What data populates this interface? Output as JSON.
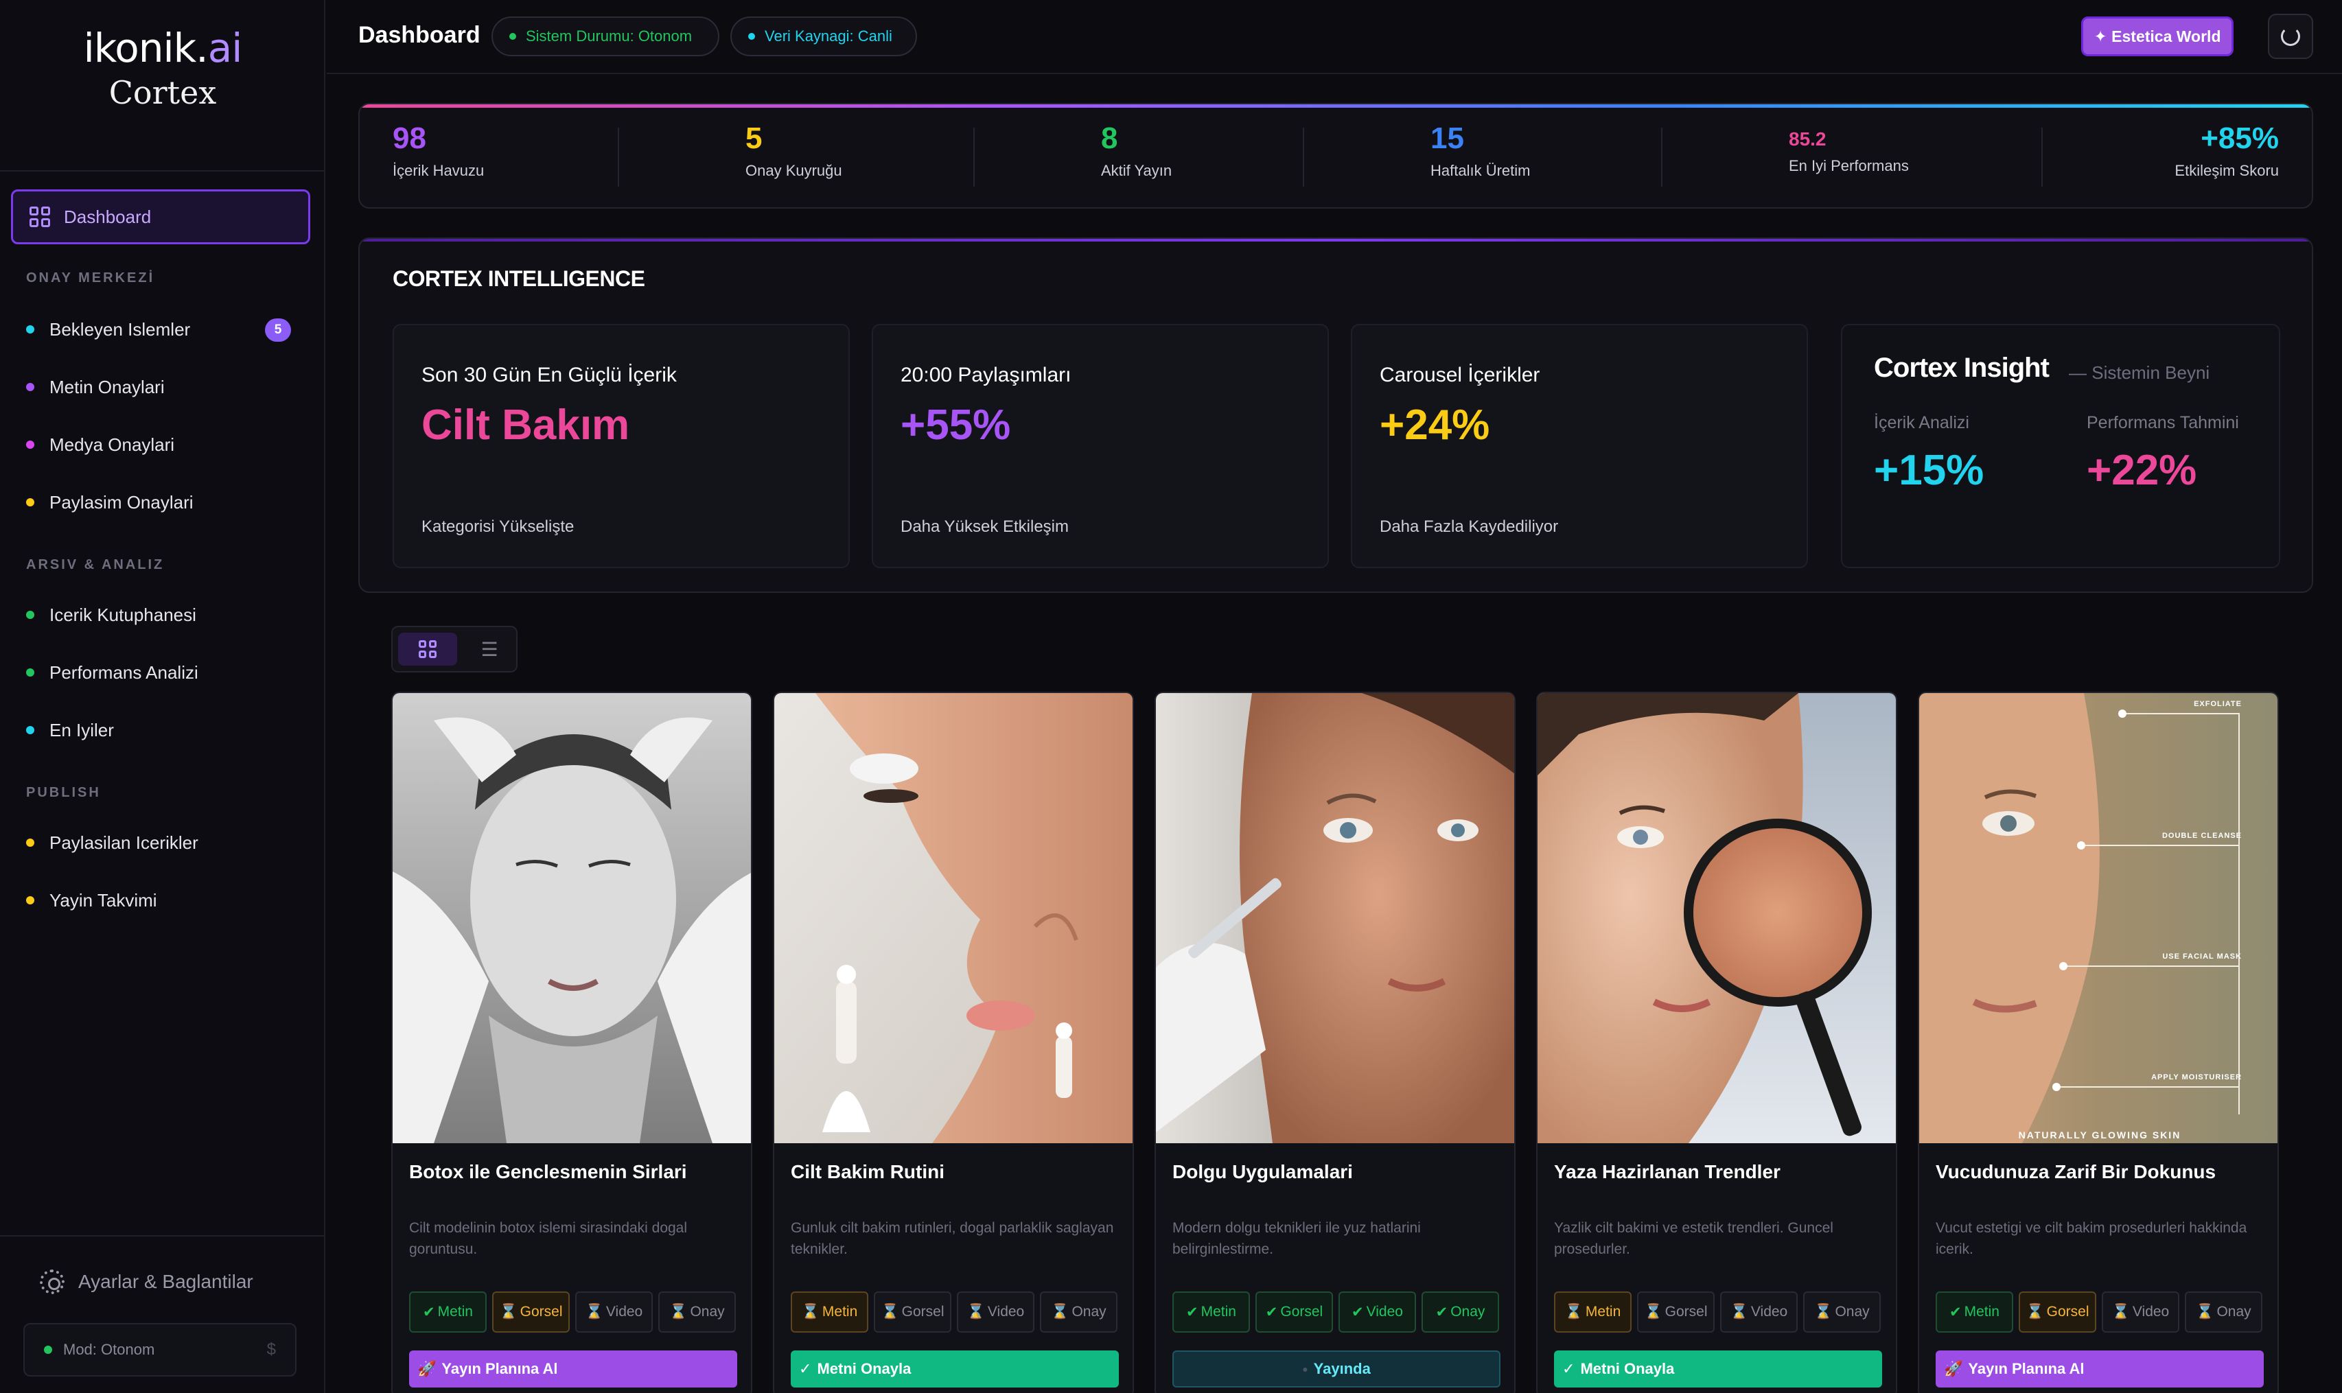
{
  "sidebar": {
    "logo": {
      "main": "ikonik.",
      "ai": "ai",
      "sub": "Cortex"
    },
    "active_item": "Dashboard",
    "sections": [
      {
        "title": "ONAY MERKEZİ",
        "items": [
          {
            "label": "Bekleyen Islemler",
            "color": "#22d3ee",
            "badge": "5"
          },
          {
            "label": "Metin Onaylari",
            "color": "#a855f7"
          },
          {
            "label": "Medya Onaylari",
            "color": "#d946ef"
          },
          {
            "label": "Paylasim Onaylari",
            "color": "#facc15"
          }
        ]
      },
      {
        "title": "ARSIV & ANALIZ",
        "items": [
          {
            "label": "Icerik Kutuphanesi",
            "color": "#22c55e"
          },
          {
            "label": "Performans Analizi",
            "color": "#22c55e"
          },
          {
            "label": "En Iyiler",
            "color": "#22d3ee"
          }
        ]
      },
      {
        "title": "PUBLISH",
        "items": [
          {
            "label": "Paylasilan Icerikler",
            "color": "#facc15"
          },
          {
            "label": "Yayin Takvimi",
            "color": "#facc15"
          }
        ]
      }
    ],
    "settings_label": "Ayarlar & Baglantilar",
    "mode_label": "Mod: Otonom",
    "mode_icon": "$"
  },
  "topbar": {
    "title": "Dashboard",
    "status_pill": "Sistem Durumu: Otonom",
    "source_pill": "Veri Kaynagi: Canli",
    "brand_button": "✦ Estetica World"
  },
  "stats": [
    {
      "value": "98",
      "label": "İçerik Havuzu",
      "color": "#a855f7"
    },
    {
      "value": "5",
      "label": "Onay Kuyruğu",
      "color": "#facc15"
    },
    {
      "value": "8",
      "label": "Aktif Yayın",
      "color": "#22c55e"
    },
    {
      "value": "15",
      "label": "Haftalık Üretim",
      "color": "#3b82f6"
    },
    {
      "value": "85.2",
      "label": "En Iyi Performans",
      "color": "#ec4899"
    },
    {
      "value": "+85%",
      "label": "Etkileşim Skoru",
      "color": "#22d3ee"
    }
  ],
  "intelligence": {
    "title": "CORTEX INTELLIGENCE",
    "cards": [
      {
        "head": "Son 30 Gün En Güçlü İçerik",
        "big": "Cilt Bakım",
        "foot": "Kategorisi Yükselişte",
        "color": "#ec4899"
      },
      {
        "head": "20:00 Paylaşımları",
        "big": "+55%",
        "foot": "Daha Yüksek Etkileşim",
        "color": "#a855f7"
      },
      {
        "head": "Carousel İçerikler",
        "big": "+24%",
        "foot": "Daha Fazla Kaydediliyor",
        "color": "#facc15"
      }
    ],
    "insight": {
      "title": "Cortex Insight",
      "subtitle": "— Sistemin Beyni",
      "left_label": "İçerik Analizi",
      "left_value": "+15%",
      "left_color": "#22d3ee",
      "right_label": "Performans Tahmini",
      "right_value": "+22%",
      "right_color": "#ec4899"
    }
  },
  "view_toggle": {
    "list_icon": "☰"
  },
  "cards": [
    {
      "title": "Botox ile Genclesmenin Sirlari",
      "desc": "Cilt modelinin botox islemi sirasindaki dogal goruntusu.",
      "tags": [
        {
          "label": "Metin",
          "state": "ok",
          "icon": "✔"
        },
        {
          "label": "Gorsel",
          "state": "warn",
          "icon": "⌛"
        },
        {
          "label": "Video",
          "state": "idle",
          "icon": "⌛"
        },
        {
          "label": "Onay",
          "state": "idle",
          "icon": "⌛"
        }
      ],
      "action": {
        "label": "Yayın Planına Al",
        "style": "purple",
        "icon": "🚀"
      }
    },
    {
      "title": "Cilt Bakim Rutini",
      "desc": "Gunluk cilt bakim rutinleri, dogal parlaklik saglayan teknikler.",
      "tags": [
        {
          "label": "Metin",
          "state": "warn",
          "icon": "⌛"
        },
        {
          "label": "Gorsel",
          "state": "idle",
          "icon": "⌛"
        },
        {
          "label": "Video",
          "state": "idle",
          "icon": "⌛"
        },
        {
          "label": "Onay",
          "state": "idle",
          "icon": "⌛"
        }
      ],
      "action": {
        "label": "Metni Onayla",
        "style": "green",
        "icon": "✓"
      }
    },
    {
      "title": "Dolgu Uygulamalari",
      "desc": "Modern dolgu teknikleri ile yuz hatlarini belirginlestirme.",
      "tags": [
        {
          "label": "Metin",
          "state": "ok",
          "icon": "✔"
        },
        {
          "label": "Gorsel",
          "state": "ok",
          "icon": "✔"
        },
        {
          "label": "Video",
          "state": "ok",
          "icon": "✔"
        },
        {
          "label": "Onay",
          "state": "ok",
          "icon": "✔"
        }
      ],
      "action": {
        "label": "Yayında",
        "style": "live",
        "icon": "●"
      }
    },
    {
      "title": "Yaza Hazirlanan Trendler",
      "desc": "Yazlik cilt bakimi ve estetik trendleri. Guncel prosedurler.",
      "tags": [
        {
          "label": "Metin",
          "state": "warn",
          "icon": "⌛"
        },
        {
          "label": "Gorsel",
          "state": "idle",
          "icon": "⌛"
        },
        {
          "label": "Video",
          "state": "idle",
          "icon": "⌛"
        },
        {
          "label": "Onay",
          "state": "idle",
          "icon": "⌛"
        }
      ],
      "action": {
        "label": "Metni Onayla",
        "style": "green",
        "icon": "✓"
      }
    },
    {
      "title": "Vucudunuza Zarif Bir Dokunus",
      "desc": "Vucut estetigi ve cilt bakim prosedurleri hakkinda icerik.",
      "tags": [
        {
          "label": "Metin",
          "state": "ok",
          "icon": "✔"
        },
        {
          "label": "Gorsel",
          "state": "warn",
          "icon": "⌛"
        },
        {
          "label": "Video",
          "state": "idle",
          "icon": "⌛"
        },
        {
          "label": "Onay",
          "state": "idle",
          "icon": "⌛"
        }
      ],
      "action": {
        "label": "Yayın Planına Al",
        "style": "purple",
        "icon": "🚀"
      },
      "image_labels": [
        "EXFOLIATE",
        "DOUBLE CLEANSE",
        "USE FACIAL MASK",
        "APPLY MOISTURISER",
        "NATURALLY GLOWING SKIN"
      ]
    }
  ]
}
